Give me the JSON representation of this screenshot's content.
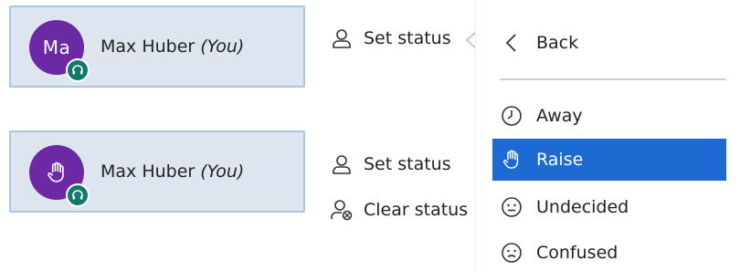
{
  "users": [
    {
      "initials": "Ma",
      "name": "Max Huber",
      "you_label": "(You)"
    },
    {
      "initials": "",
      "name": "Max Huber",
      "you_label": "(You)"
    }
  ],
  "menu_top": {
    "set_status": "Set status"
  },
  "menu_bottom": {
    "set_status": "Set status",
    "clear_status": "Clear status"
  },
  "submenu": {
    "back": "Back",
    "items": [
      {
        "label": "Away",
        "icon": "clock-icon"
      },
      {
        "label": "Raise",
        "icon": "raised-hand-icon",
        "selected": true
      },
      {
        "label": "Undecided",
        "icon": "neutral-face-icon"
      },
      {
        "label": "Confused",
        "icon": "confused-face-icon"
      }
    ]
  },
  "colors": {
    "avatar": "#6b2aa3",
    "badge": "#0f7a6a",
    "selection": "#1d6ad3",
    "card": "#dde5ef"
  }
}
